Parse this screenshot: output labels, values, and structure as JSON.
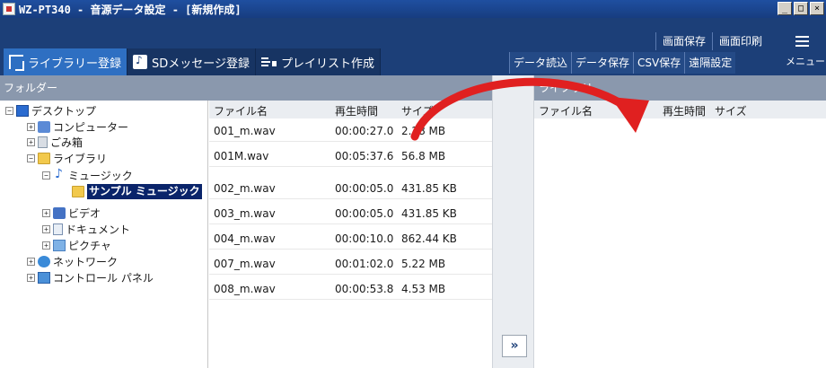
{
  "window": {
    "title": "WZ-PT340 - 音源データ設定 - [新規作成]",
    "buttons": [
      "_",
      "□",
      "×"
    ]
  },
  "tabs": [
    {
      "label": "ライブラリー登録",
      "icon": "library-icon",
      "active": true
    },
    {
      "label": "SDメッセージ登録",
      "icon": "sd-message-icon",
      "active": false
    },
    {
      "label": "プレイリスト作成",
      "icon": "playlist-icon",
      "active": false
    }
  ],
  "toolbar_top": [
    "画面保存",
    "画面印刷"
  ],
  "toolbar_bottom": [
    "データ読込",
    "データ保存",
    "CSV保存",
    "遠隔設定"
  ],
  "menu": {
    "label": "メニュー",
    "icon": "hamburger-menu-icon"
  },
  "folder_panel": {
    "header": "フォルダー",
    "tree": [
      {
        "label": "デスクトップ",
        "icon": "desktop-icon",
        "expander": "−"
      },
      {
        "label": "コンピューター",
        "icon": "computer-icon",
        "expander": "+"
      },
      {
        "label": "ごみ箱",
        "icon": "recycle-bin-icon",
        "expander": "+"
      },
      {
        "label": "ライブラリ",
        "icon": "library-folder-icon",
        "expander": "−"
      },
      {
        "label": "ミュージック",
        "icon": "music-icon",
        "expander": "−"
      },
      {
        "label": "サンプル ミュージック",
        "icon": "folder-icon",
        "expander": "",
        "selected": true
      },
      {
        "label": "ビデオ",
        "icon": "video-icon",
        "expander": "+"
      },
      {
        "label": "ドキュメント",
        "icon": "document-icon",
        "expander": "+"
      },
      {
        "label": "ピクチャ",
        "icon": "picture-icon",
        "expander": "+"
      },
      {
        "label": "ネットワーク",
        "icon": "network-icon",
        "expander": "+"
      },
      {
        "label": "コントロール パネル",
        "icon": "control-panel-icon",
        "expander": "+"
      }
    ]
  },
  "file_list": {
    "columns": [
      "ファイル名",
      "再生時間",
      "サイズ"
    ],
    "rows": [
      [
        "001_m.wav",
        "00:00:27.0",
        "2.28 MB"
      ],
      [
        "001M.wav",
        "00:05:37.6",
        "56.8 MB"
      ],
      [
        "002_m.wav",
        "00:00:05.0",
        "431.85 KB"
      ],
      [
        "003_m.wav",
        "00:00:05.0",
        "431.85 KB"
      ],
      [
        "004_m.wav",
        "00:00:10.0",
        "862.44 KB"
      ],
      [
        "007_m.wav",
        "00:01:02.0",
        "5.22 MB"
      ],
      [
        "008_m.wav",
        "00:00:53.8",
        "4.53 MB"
      ]
    ]
  },
  "move_button": "»",
  "library_panel": {
    "header": "ライブラリ",
    "columns": [
      "ファイル名",
      "再生時間",
      "サイズ"
    ]
  },
  "colors": {
    "header_bg": "#1c3f78",
    "active_tab": "#2e6fc2",
    "arrow": "#e02020",
    "selection": "#0a246a"
  }
}
